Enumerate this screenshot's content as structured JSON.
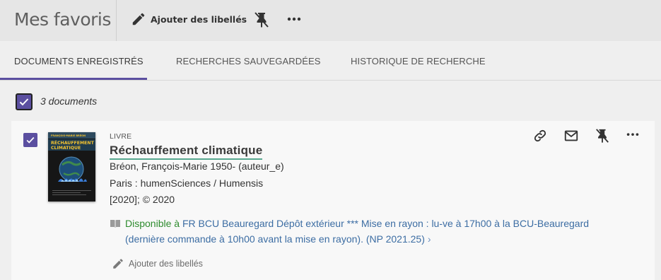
{
  "header": {
    "title": "Mes favoris",
    "add_labels": "Ajouter des libellés",
    "icons": {
      "edit": "pencil-icon",
      "unpin": "unpin-icon",
      "more": "more-icon"
    }
  },
  "tabs": [
    {
      "label": "DOCUMENTS ENREGISTRÉS",
      "active": true
    },
    {
      "label": "RECHERCHES SAUVEGARDÉES",
      "active": false
    },
    {
      "label": "HISTORIQUE DE RECHERCHE",
      "active": false
    }
  ],
  "selection": {
    "count_text": "3 documents",
    "checked": true
  },
  "results": [
    {
      "type": "LIVRE",
      "title": "Réchauffement climatique",
      "author": "Bréon, François-Marie 1950- (auteur_e)",
      "publisher": "Paris : humenSciences / Humensis",
      "date": "[2020]; © 2020",
      "availability": {
        "status": "Disponible à",
        "location": "FR BCU Beauregard  Dépôt extérieur *** Mise en rayon : lu-ve à 17h00 à la BCU-Beauregard (dernière commande à 10h00 avant la mise en rayon). (NP 2021.25)",
        "chevron": "›"
      },
      "add_labels": "Ajouter des libellés",
      "cover": {
        "top_text": "FRANÇOIS-MARIE BRÉON",
        "title_text": "RÉCHAUFFEMENT CLIMATIQUE"
      },
      "actions": [
        "link-icon",
        "mail-icon",
        "unpin-icon",
        "more-icon"
      ]
    }
  ],
  "colors": {
    "accent": "#5b4fa0",
    "available": "#2e8b2e",
    "link": "#3c6da3",
    "title_underline": "#57a88f"
  }
}
